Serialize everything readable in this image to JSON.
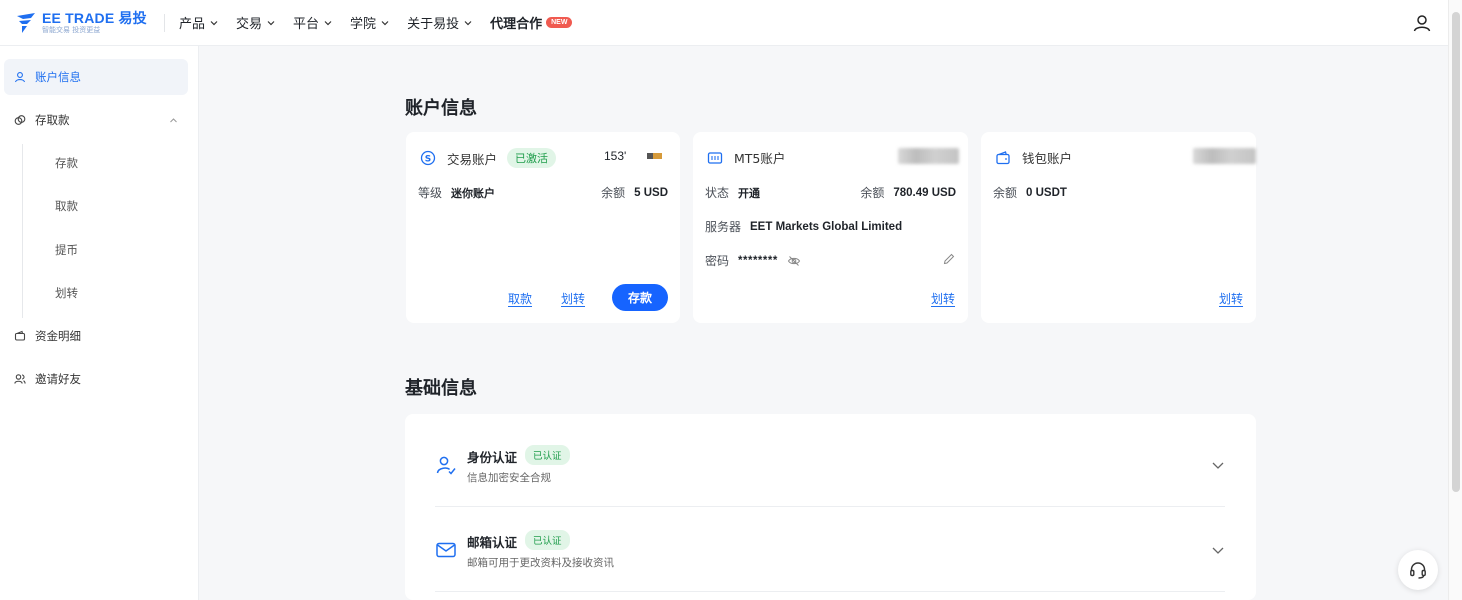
{
  "brand": {
    "name": "EE TRADE 易投",
    "tagline": "智能交易 投资更益"
  },
  "nav": {
    "items": [
      {
        "label": "产品"
      },
      {
        "label": "交易"
      },
      {
        "label": "平台"
      },
      {
        "label": "学院"
      },
      {
        "label": "关于易投"
      }
    ],
    "partner_label": "代理合作",
    "new_badge": "NEW"
  },
  "sidebar": {
    "account_info": "账户信息",
    "deposit_withdraw": "存取款",
    "sub": [
      "存款",
      "取款",
      "提币",
      "划转"
    ],
    "fund_details": "资金明细",
    "invite": "邀请好友"
  },
  "account_section_title": "账户信息",
  "trading_card": {
    "title": "交易账户",
    "status_tag": "已激活",
    "account_number": "153'",
    "level_label": "等级",
    "level_value": "迷你账户",
    "balance_label": "余额",
    "balance_value": "5 USD",
    "withdraw_link": "取款",
    "transfer_link": "划转",
    "deposit_button": "存款"
  },
  "mt5_card": {
    "title": "MT5账户",
    "status_label": "状态",
    "status_value": "开通",
    "balance_label": "余额",
    "balance_value": "780.49 USD",
    "server_label": "服务器",
    "server_value": "EET Markets Global Limited",
    "password_label": "密码",
    "password_value": "********",
    "transfer_link": "划转"
  },
  "wallet_card": {
    "title": "钱包账户",
    "balance_label": "余额",
    "balance_value": "0 USDT",
    "transfer_link": "划转"
  },
  "basic_section_title": "基础信息",
  "basic_rows": [
    {
      "title": "身份认证",
      "tag": "已认证",
      "desc": "信息加密安全合规"
    },
    {
      "title": "邮箱认证",
      "tag": "已认证",
      "desc": "邮箱可用于更改资料及接收资讯"
    }
  ],
  "colors": {
    "accent": "#1664ff",
    "verified_green": "#1f9d4b",
    "new_badge": "#f05a50"
  },
  "icons": [
    "brand-logo-icon",
    "chevron-down-icon",
    "user-icon",
    "dollar-circle-icon",
    "mt5-icon",
    "wallet-icon",
    "eye-off-icon",
    "pencil-icon",
    "id-verify-icon",
    "mail-icon",
    "headset-icon"
  ]
}
